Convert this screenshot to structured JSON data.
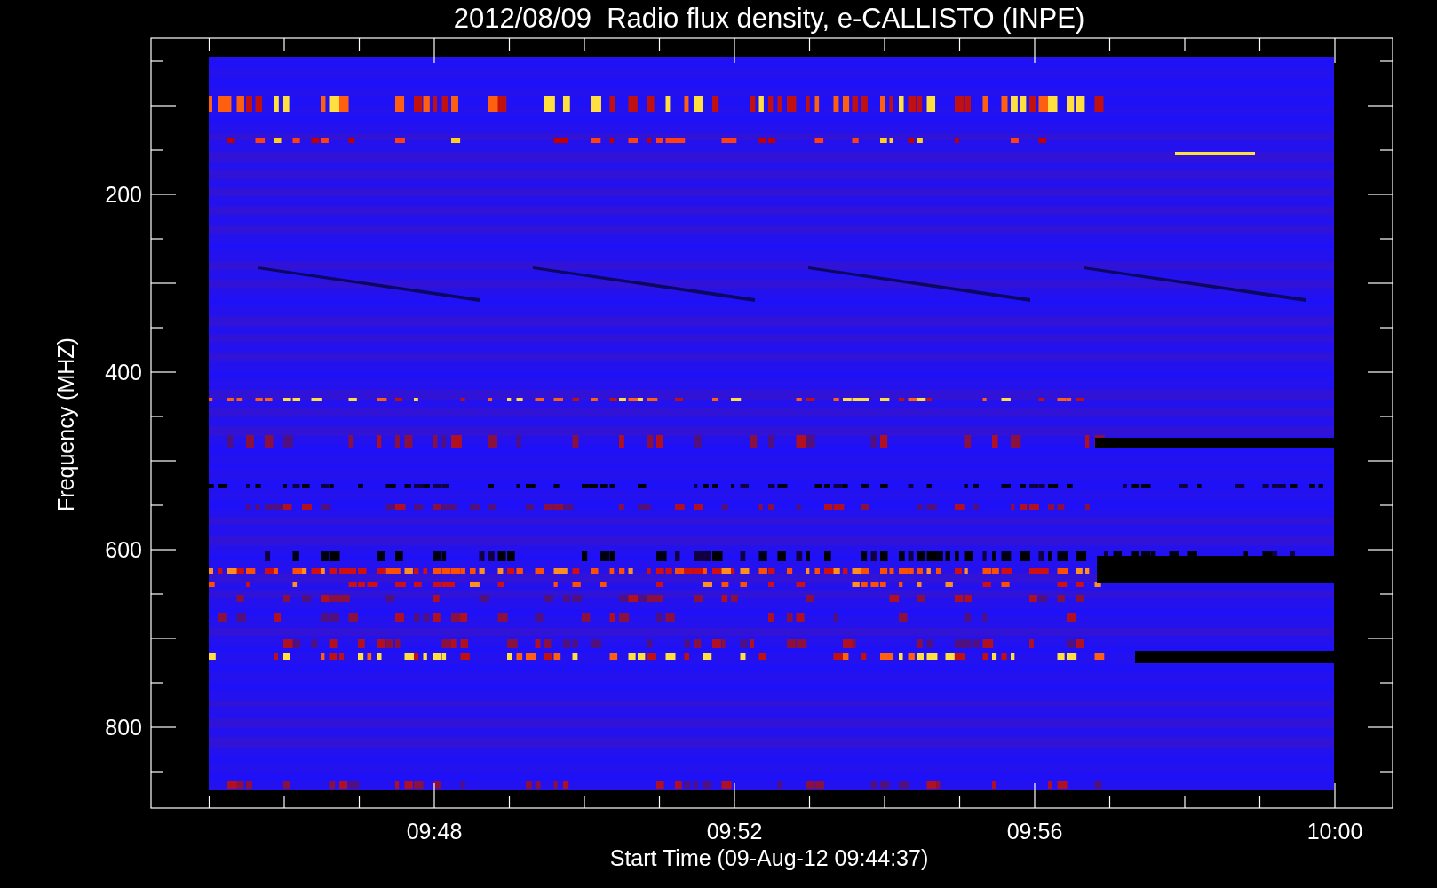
{
  "title": "2012/08/09  Radio flux density, e-CALLISTO (INPE)",
  "y_axis": {
    "label": "Frequency (MHZ)",
    "ticks": [
      "200",
      "400",
      "600",
      "800"
    ]
  },
  "x_axis": {
    "label": "Start Time (09-Aug-12 09:44:37)",
    "ticks": [
      "09:48",
      "09:52",
      "09:56",
      "10:00"
    ]
  }
}
